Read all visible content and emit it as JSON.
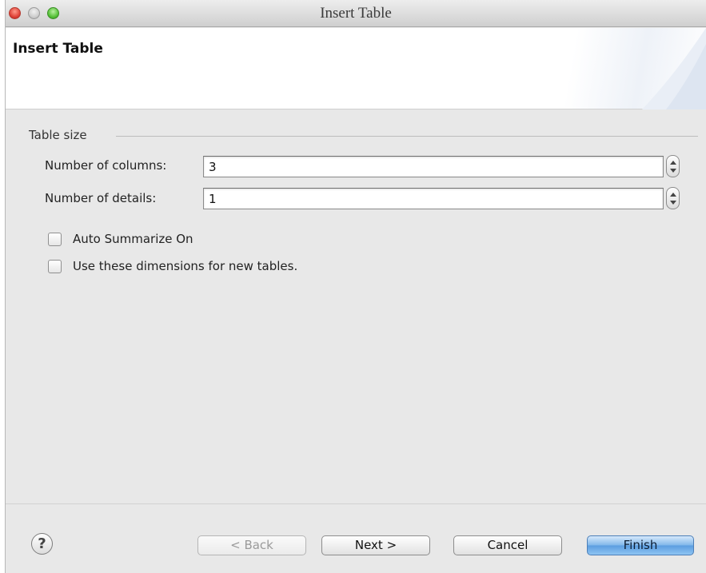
{
  "window": {
    "title": "Insert Table"
  },
  "banner": {
    "title": "Insert Table"
  },
  "table_size": {
    "group_label": "Table size",
    "columns_label": "Number of columns:",
    "columns_value": "3",
    "details_label": "Number of details:",
    "details_value": "1"
  },
  "options": {
    "auto_summarize_label": "Auto Summarize On",
    "auto_summarize_checked": false,
    "use_dimensions_label": "Use these dimensions for new tables.",
    "use_dimensions_checked": false
  },
  "footer": {
    "help_glyph": "?",
    "back_label": "< Back",
    "next_label": "Next >",
    "cancel_label": "Cancel",
    "finish_label": "Finish"
  },
  "icons": {
    "help": "question-mark-icon",
    "close": "close-traffic-light",
    "minimize": "minimize-traffic-light",
    "maximize": "maximize-traffic-light"
  },
  "colors": {
    "close": "#e0443a",
    "maximize": "#58c23a",
    "default_button": "#5a9de0"
  }
}
